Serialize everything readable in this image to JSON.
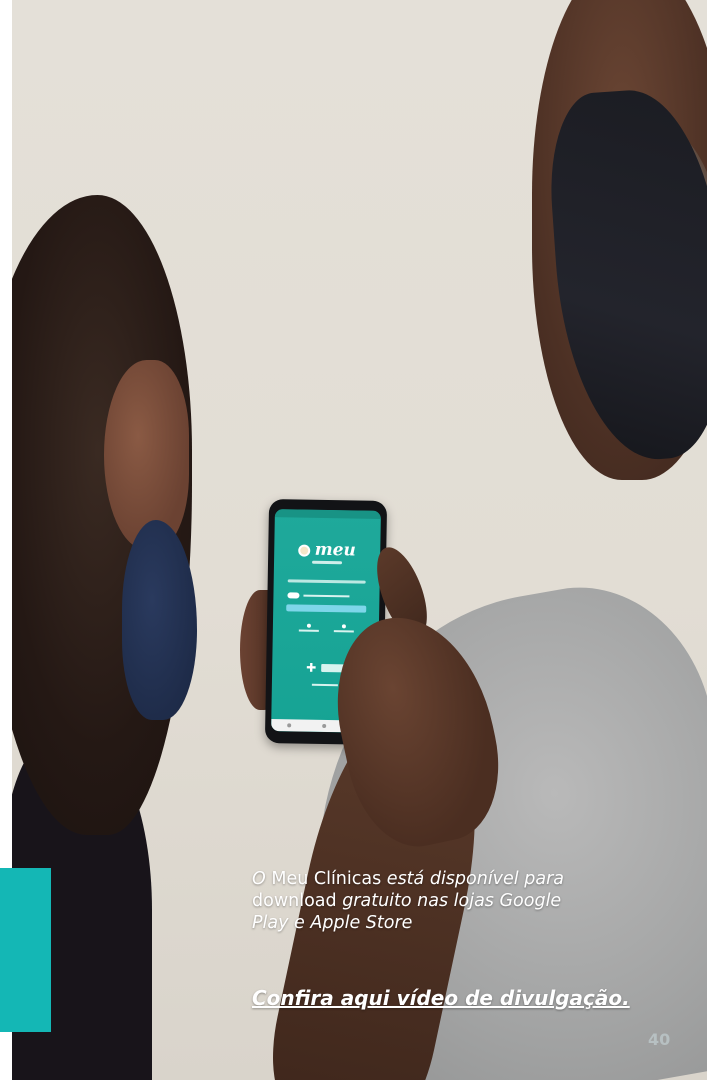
{
  "caption": {
    "line1_a": "O ",
    "line1_b": "Meu Clínicas",
    "line1_c": " está disponível para",
    "line2_a": "download",
    "line2_b": " gratuito nas lojas Google",
    "line3": "Play e Apple Store"
  },
  "cta": {
    "label": "Confira aqui vídeo de divulgação."
  },
  "page": {
    "number": "40"
  },
  "phone_app": {
    "logo_text": "meu"
  },
  "colors": {
    "accent_teal": "#14b7b5",
    "app_green": "#1fa99b",
    "caption_text": "#ffffff"
  }
}
